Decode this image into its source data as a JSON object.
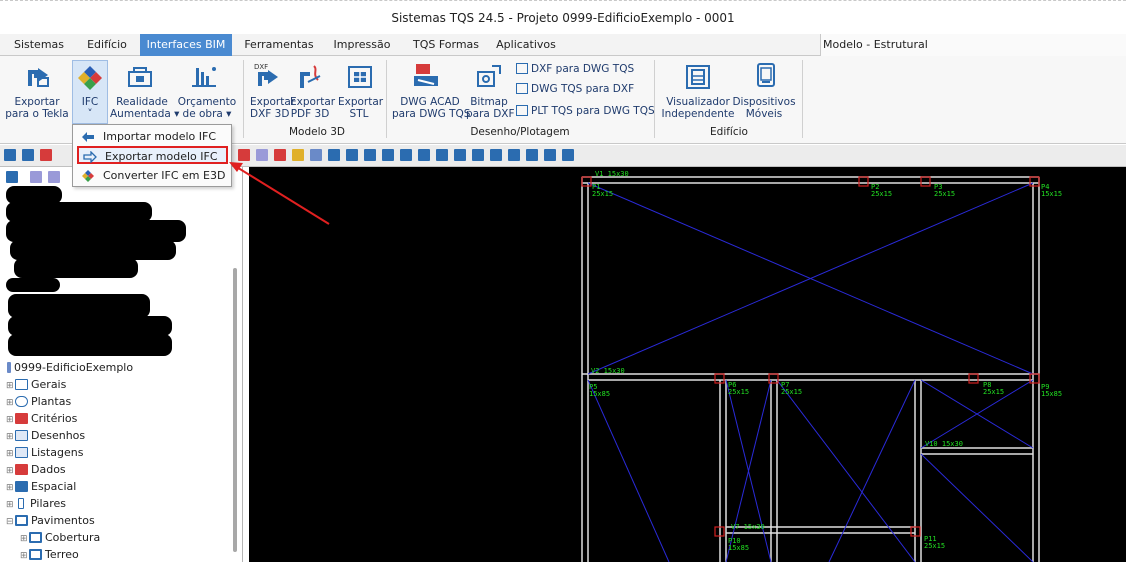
{
  "window": {
    "title": "Sistemas TQS 24.5 - Projeto 0999-EdificioExemplo - 0001"
  },
  "menu": {
    "tabs": [
      {
        "label": "Sistemas"
      },
      {
        "label": "Edifício"
      },
      {
        "label": "Interfaces BIM"
      },
      {
        "label": "Ferramentas"
      },
      {
        "label": "Impressão"
      },
      {
        "label": "TQS Formas"
      },
      {
        "label": "Aplicativos"
      }
    ],
    "active_tab": "Interfaces BIM",
    "model_label": "Modelo - Estrutural"
  },
  "ribbon": {
    "buttons": {
      "exportar_tekla": {
        "line1": "Exportar",
        "line2": "para o Tekla"
      },
      "ifc": {
        "line1": "IFC",
        "line2": "˅"
      },
      "realidade": {
        "line1": "Realidade",
        "line2": "Aumentada ▾"
      },
      "orcamento": {
        "line1": "Orçamento",
        "line2": "de obra ▾"
      },
      "dxf3d": {
        "line1": "Exportar",
        "line2": "DXF 3D",
        "badge": "DXF"
      },
      "pdf3d": {
        "line1": "Exportar",
        "line2": "PDF 3D"
      },
      "stl": {
        "line1": "Exportar",
        "line2": "STL"
      },
      "dwg_acad": {
        "line1": "DWG ACAD",
        "line2": "para DWG TQS"
      },
      "bitmap": {
        "line1": "Bitmap",
        "line2": "para DXF"
      },
      "dxf_dwg": {
        "label": "DXF para DWG TQS"
      },
      "dwg_dxf": {
        "label": "DWG TQS para DXF"
      },
      "plt_dwg": {
        "label": "PLT TQS para DWG TQS"
      },
      "visualizador": {
        "line1": "Visualizador",
        "line2": "Independente"
      },
      "dispositivos": {
        "line1": "Dispositivos",
        "line2": "Móveis"
      }
    },
    "groups": {
      "modelo3d": "Modelo 3D",
      "desenho": "Desenho/Plotagem",
      "edificio": "Edifício"
    }
  },
  "dropdown": {
    "items": [
      {
        "label": "Importar modelo IFC"
      },
      {
        "label": "Exportar modelo IFC"
      },
      {
        "label": "Converter IFC em E3D"
      }
    ]
  },
  "tree": {
    "project": "0999-EdificioExemplo",
    "items": [
      {
        "label": "Gerais"
      },
      {
        "label": "Plantas"
      },
      {
        "label": "Critérios"
      },
      {
        "label": "Desenhos"
      },
      {
        "label": "Listagens"
      },
      {
        "label": "Dados"
      },
      {
        "label": "Espacial"
      },
      {
        "label": "Pilares"
      },
      {
        "label": "Pavimentos"
      }
    ],
    "sub_items": [
      {
        "label": "Cobertura"
      },
      {
        "label": "Terreo"
      }
    ]
  },
  "drawing": {
    "labels": {
      "v1": "V1 15x30",
      "v2": "V2 15x30",
      "v7": "V7 15x30",
      "v10": "V10 15x30",
      "p1": "P1",
      "p1s": "25x15",
      "p2": "P2",
      "p2s": "25x15",
      "p3": "P3",
      "p3s": "25x15",
      "p4": "P4",
      "p4s": "15x15",
      "p5": "P5",
      "p5s": "15x85",
      "p6": "P6",
      "p6s": "25x15",
      "p7": "P7",
      "p7s": "25x15",
      "p8": "P8",
      "p8s": "25x15",
      "p9": "P9",
      "p9s": "15x85",
      "p10": "P10",
      "p10s": "15x85",
      "p11": "P11",
      "p11s": "25x15"
    }
  },
  "colors": {
    "active_tab": "#4a8ad1",
    "canvas_bg": "#000000",
    "beam": "#e0e0e0",
    "diagonal": "#2a2ad8",
    "pillar": "#d02020",
    "label": "#22e022",
    "highlight": "#e02020"
  }
}
